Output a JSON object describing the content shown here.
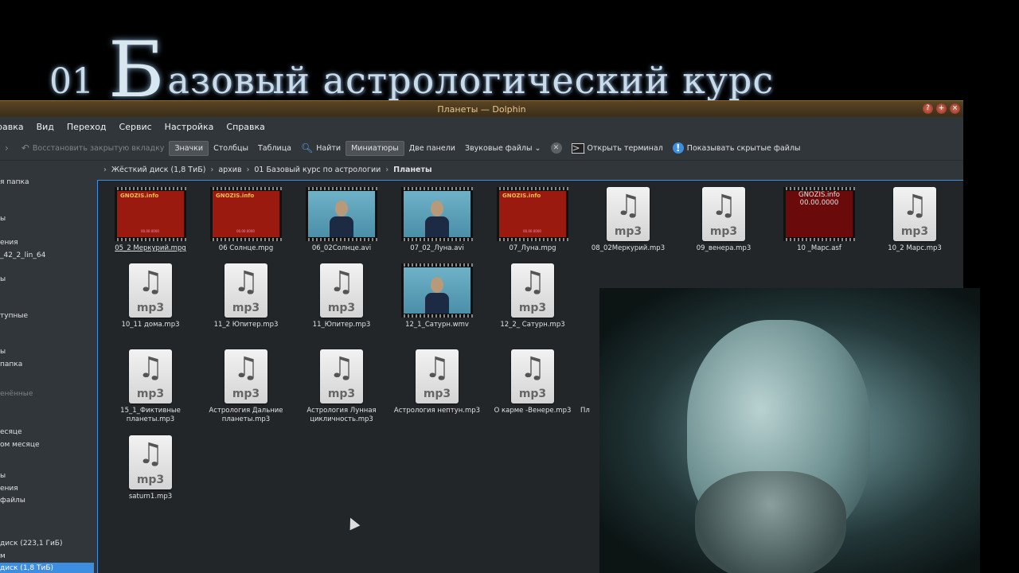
{
  "banner": {
    "number": "01",
    "capital": "Б",
    "text": "азовый астрологический курс"
  },
  "window": {
    "title": "Планеты — Dolphin",
    "controls": [
      "?",
      "+",
      "×"
    ]
  },
  "menu": [
    "равка",
    "Вид",
    "Переход",
    "Сервис",
    "Настройка",
    "Справка"
  ],
  "toolbar": {
    "restore_tab": "Восстановить закрытую вкладку",
    "icons": "Значки",
    "columns": "Столбцы",
    "table": "Таблица",
    "find": "Найти",
    "thumbnails": "Миниатюры",
    "two_panels": "Две панели",
    "audio_files": "Звуковые файлы",
    "open_terminal": "Открыть терминал",
    "show_hidden": "Показывать скрытые файлы"
  },
  "breadcrumb": [
    "Жёсткий диск (1,8 ТиБ)",
    "архив",
    "01 Базовый курс по астрологии",
    "Планеты"
  ],
  "sidebar": {
    "items": [
      {
        "label": "я папка"
      },
      {
        "label": "ы"
      },
      {
        "label": "ения"
      },
      {
        "label": "_42_2_lin_64"
      },
      {
        "label": "ы"
      },
      {
        "label": "тупные"
      },
      {
        "label": "ы"
      },
      {
        "label": "папка"
      },
      {
        "label": "енённые",
        "heading": true
      },
      {
        "label": "есяце"
      },
      {
        "label": "ом месяце"
      },
      {
        "label": "ы"
      },
      {
        "label": "ения"
      },
      {
        "label": "файлы"
      },
      {
        "label": "диск (223,1 ГиБ)"
      },
      {
        "label": "м"
      },
      {
        "label": "диск (1,8 ТиБ)",
        "selected": true
      }
    ]
  },
  "files": [
    {
      "name": "05_2 Меркурий.mpg",
      "kind": "video-red",
      "selected": true
    },
    {
      "name": "06 Солнце.mpg",
      "kind": "video-red"
    },
    {
      "name": "06_02Солнце.avi",
      "kind": "video-blue"
    },
    {
      "name": "07_02_Луна.avi",
      "kind": "video-blue"
    },
    {
      "name": "07_Луна.mpg",
      "kind": "video-red"
    },
    {
      "name": "08_02Меркурий.mp3",
      "kind": "mp3"
    },
    {
      "name": "09_венера.mp3",
      "kind": "mp3"
    },
    {
      "name": "10 _Марс.asf",
      "kind": "video-dark"
    },
    {
      "name": "10_2 Марс.mp3",
      "kind": "mp3"
    },
    {
      "name": "10_11 дома.mp3",
      "kind": "mp3"
    },
    {
      "name": "11_2 Юпитер.mp3",
      "kind": "mp3"
    },
    {
      "name": "11_Юпитер.mp3",
      "kind": "mp3"
    },
    {
      "name": "12_1_Сатурн.wmv",
      "kind": "video-blue"
    },
    {
      "name": "12_2_ Сатурн.mp3",
      "kind": "mp3"
    },
    {
      "name": "15_1_Фиктивные планеты.mp3",
      "kind": "mp3"
    },
    {
      "name": "Астрология Дальние планеты.mp3",
      "kind": "mp3"
    },
    {
      "name": "Астрология Лунная цикличность.mp3",
      "kind": "mp3"
    },
    {
      "name": "Астрология нептун.mp3",
      "kind": "mp3"
    },
    {
      "name": "О карме -Венере.mp3",
      "kind": "mp3"
    },
    {
      "name": "Пл",
      "kind": "partial"
    },
    {
      "name": "saturn1.mp3",
      "kind": "mp3"
    }
  ],
  "thumb_text": {
    "logo": "GNOZIS.info",
    "date": "00.00.0000"
  },
  "icons": {
    "mp3_note": "music-note-icon",
    "mp3_ext": "mp3"
  },
  "colors": {
    "accent": "#3d8ee0",
    "window_bg": "#31363b",
    "view_bg": "#232629",
    "title_bar": "#5b4524"
  }
}
